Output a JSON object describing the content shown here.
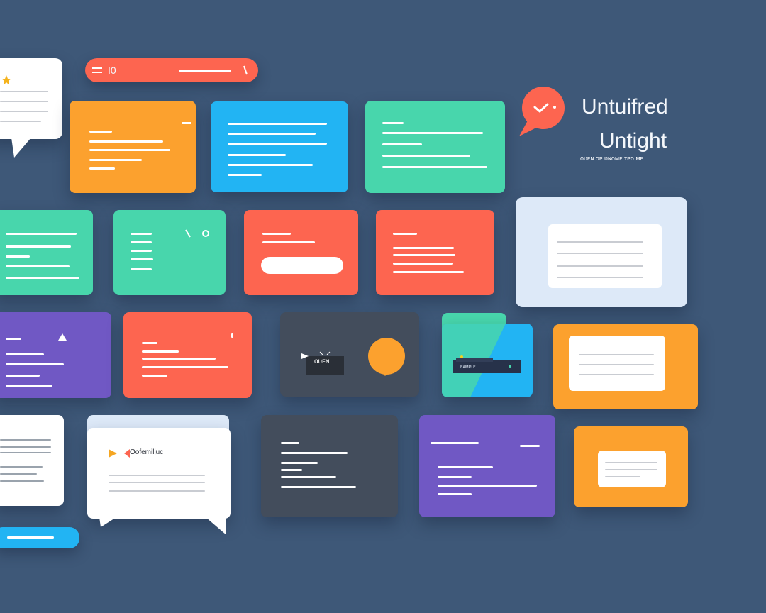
{
  "colors": {
    "background": "#3e5878",
    "orange": "#fca12e",
    "blue": "#22b4f3",
    "green": "#48d6ac",
    "red": "#fd6550",
    "purple": "#7058c4",
    "dark": "#434d5c",
    "white": "#ffffff",
    "pale": "#dde9f8"
  },
  "header": {
    "title": "Untuifred",
    "subtitle": "Untight",
    "caption": "ᴏᴜᴇɴ ᴏᴘ ᴜɴᴏᴍᴇ ᴛᴘᴏ ᴍᴇ"
  },
  "top_pill": {
    "label": "I0"
  },
  "tiles": {
    "player_label": "ᴏᴜᴇɴ",
    "chat_caption": "Oofemiljuc",
    "device_label": "ᴇᴀᴍᴘʟᴇ"
  },
  "icons": {
    "chat_bubble": "chat-bubble-icon",
    "check": "check-icon",
    "star": "star-icon",
    "play": "play-icon",
    "menu": "menu-icon",
    "search": "search-icon",
    "device": "device-icon"
  }
}
